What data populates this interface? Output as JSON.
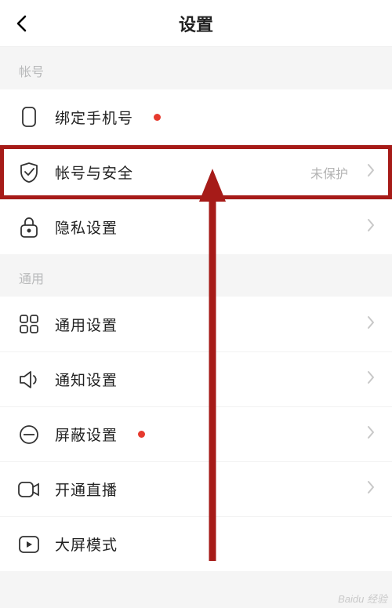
{
  "header": {
    "title": "设置"
  },
  "sections": {
    "account": {
      "label": "帐号"
    },
    "general": {
      "label": "通用"
    }
  },
  "rows": {
    "bind_phone": {
      "label": "绑定手机号"
    },
    "account_security": {
      "label": "帐号与安全",
      "value": "未保护"
    },
    "privacy": {
      "label": "隐私设置"
    },
    "general": {
      "label": "通用设置"
    },
    "notification": {
      "label": "通知设置"
    },
    "block": {
      "label": "屏蔽设置"
    },
    "live": {
      "label": "开通直播"
    },
    "bigscreen": {
      "label": "大屏模式"
    }
  },
  "watermark": "Baidu 经验",
  "annotation_color": "#a61b18"
}
